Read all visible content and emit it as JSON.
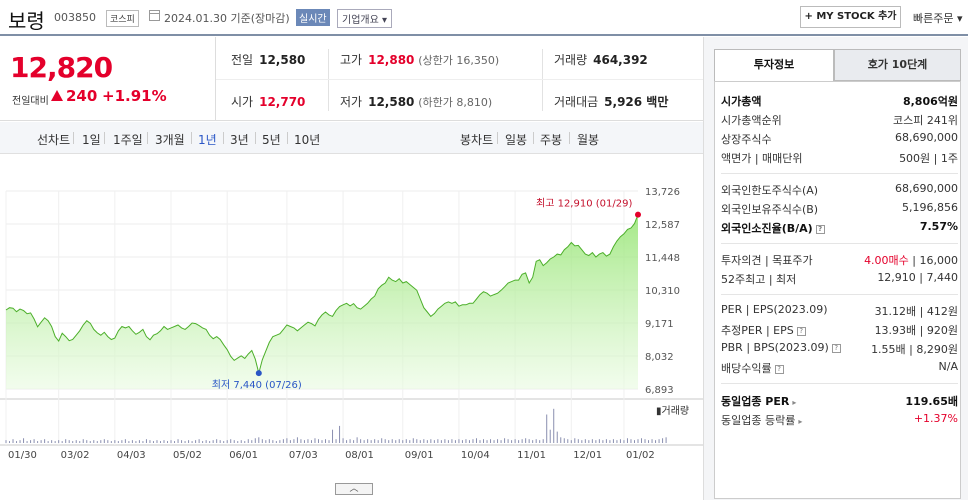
{
  "header": {
    "stock_name": "보령",
    "stock_code": "003850",
    "market": "코스피",
    "date_text": "2024.01.30 기준(장마감)",
    "realtime_label": "실시간",
    "company_info_label": "기업개요 ▾",
    "my_stock_label": "+ MY STOCK 추가",
    "quick_order_label": "빠른주문 ▾"
  },
  "price": {
    "current": "12,820",
    "change_label": "전일대비",
    "change": "240",
    "change_pct": "+1.91%"
  },
  "stats": {
    "prev_label": "전일",
    "prev": "12,580",
    "high_label": "고가",
    "high": "12,880",
    "upper_limit": "(상한가 16,350)",
    "volume_label": "거래량",
    "volume": "464,392",
    "open_label": "시가",
    "open": "12,770",
    "low_label": "저가",
    "low": "12,580",
    "lower_limit": "(하한가 8,810)",
    "amount_label": "거래대금",
    "amount": "5,926 백만"
  },
  "periods": {
    "line_label": "선차트",
    "line_items": [
      "1일",
      "1주일",
      "3개월",
      "1년",
      "3년",
      "5년",
      "10년"
    ],
    "selected": "1년",
    "candle_label": "봉차트",
    "candle_items": [
      "일봉",
      "주봉",
      "월봉"
    ]
  },
  "panel": {
    "tab_active": "투자정보",
    "tab_inactive": "호가 10단계",
    "market_cap_label": "시가총액",
    "market_cap": "8,806억원",
    "rank_label": "시가총액순위",
    "rank": "코스피 241위",
    "shares_label": "상장주식수",
    "shares": "68,690,000",
    "par_label": "액면가 | 매매단위",
    "par": "500원 | 1주",
    "foreign_limit_label": "외국인한도주식수(A)",
    "foreign_limit": "68,690,000",
    "foreign_hold_label": "외국인보유주식수(B)",
    "foreign_hold": "5,196,856",
    "foreign_ratio_label": "외국인소진율(B/A)",
    "foreign_ratio": "7.57%",
    "opinion_label": "투자의견 | 목표주가",
    "opinion": "4.00매수",
    "target": "| 16,000",
    "w52_label": "52주최고 | 최저",
    "w52": "12,910 | 7,440",
    "per_label": "PER | EPS(2023.09)",
    "per": "31.12배 | 412원",
    "est_per_label": "추정PER | EPS",
    "est_per": "13.93배 | 920원",
    "pbr_label": "PBR | BPS(2023.09)",
    "pbr": "1.55배 | 8,290원",
    "div_label": "배당수익률",
    "div": "N/A",
    "ind_per_label": "동일업종 PER",
    "ind_per": "119.65배",
    "ind_rate_label": "동일업종 등락률",
    "ind_rate": "+1.37%"
  },
  "chart_data": {
    "type": "area",
    "y_ticks": [
      13726,
      12587,
      11448,
      10310,
      9171,
      8032,
      6893
    ],
    "ylim": [
      6893,
      13726
    ],
    "x_tick_labels": [
      "01/30",
      "03/02",
      "04/03",
      "05/02",
      "06/01",
      "07/03",
      "08/01",
      "09/01",
      "10/04",
      "11/01",
      "12/01",
      "01/02"
    ],
    "values": [
      9620,
      9700,
      9680,
      9560,
      9650,
      9600,
      9490,
      9520,
      9310,
      9040,
      9200,
      9350,
      9250,
      9050,
      8700,
      8550,
      8820,
      8700,
      8560,
      8600,
      8750,
      8900,
      9100,
      9250,
      9160,
      8950,
      8830,
      8750,
      8850,
      8700,
      8600,
      8650,
      8900,
      9050,
      9000,
      9050,
      8900,
      8780,
      8850,
      8950,
      8700,
      8590,
      8750,
      8800,
      8900,
      9050,
      8950,
      9000,
      9050,
      9100,
      9000,
      8950,
      9050,
      9170,
      9150,
      9080,
      9000,
      8950,
      8750,
      8630,
      8700,
      8600,
      8420,
      8250,
      8020,
      7880,
      7960,
      8040,
      7950,
      8100,
      8220,
      7920,
      7440,
      7900,
      8200,
      8500,
      8700,
      8750,
      8800,
      8950,
      9100,
      9050,
      9000,
      8900,
      9000,
      9100,
      9200,
      9150,
      9070,
      9300,
      9450,
      9550,
      9450,
      9400,
      9600,
      9740,
      9800,
      9850,
      9760,
      9840,
      9700,
      9650,
      9750,
      9850,
      10000,
      10100,
      10350,
      10470,
      10550,
      10750,
      10650,
      10600,
      10700,
      10550,
      10600,
      10500,
      10400,
      10300,
      10000,
      9700,
      9550,
      9400,
      9500,
      9650,
      9750,
      9850,
      9900,
      9850,
      9900,
      9750,
      9800,
      9800,
      9850,
      9850,
      10000,
      10150,
      10250,
      10200,
      10100,
      10150,
      10200,
      10300,
      10420,
      10550,
      10600,
      10650,
      10650,
      10850,
      10900,
      10550,
      10750,
      11300,
      11350,
      11150,
      11250,
      11380,
      11450,
      11550,
      11520,
      11700,
      11800,
      11950,
      11830,
      11850,
      11700,
      11550,
      11500,
      11600,
      11450,
      11550,
      11600,
      11480,
      11550,
      11800,
      12000,
      12150,
      12250,
      12400,
      12450,
      12600,
      12910
    ],
    "high_label": "최고 12,910 (01/29)",
    "low_label": "최저 7,440 (07/26)",
    "low_index": 72,
    "volume_label": "▮거래량",
    "volumes": [
      3,
      2,
      4,
      2,
      3,
      5,
      2,
      3,
      4,
      2,
      3,
      4,
      2,
      3,
      2,
      3,
      2,
      4,
      3,
      2,
      3,
      2,
      4,
      3,
      2,
      3,
      2,
      3,
      4,
      3,
      2,
      3,
      2,
      3,
      4,
      2,
      3,
      2,
      3,
      2,
      4,
      3,
      2,
      3,
      2,
      3,
      2,
      3,
      2,
      4,
      3,
      2,
      3,
      2,
      3,
      4,
      2,
      3,
      2,
      3,
      4,
      3,
      2,
      3,
      4,
      3,
      2,
      3,
      2,
      4,
      3,
      5,
      6,
      4,
      3,
      4,
      3,
      2,
      3,
      4,
      5,
      3,
      4,
      6,
      4,
      3,
      4,
      3,
      5,
      4,
      3,
      4,
      3,
      14,
      4,
      18,
      5,
      3,
      4,
      3,
      6,
      4,
      3,
      4,
      3,
      4,
      3,
      5,
      4,
      3,
      4,
      3,
      4,
      3,
      4,
      3,
      5,
      4,
      3,
      4,
      3,
      4,
      3,
      4,
      3,
      4,
      3,
      4,
      3,
      4,
      3,
      4,
      3,
      4,
      5,
      3,
      4,
      3,
      4,
      3,
      4,
      3,
      5,
      4,
      3,
      4,
      3,
      4,
      5,
      4,
      3,
      4,
      3,
      4,
      30,
      14,
      36,
      12,
      6,
      5,
      4,
      3,
      5,
      4,
      3,
      4,
      3,
      4,
      3,
      4,
      3,
      4,
      3,
      4,
      3,
      4,
      3,
      5,
      4,
      3,
      4,
      5,
      4,
      3,
      4,
      3,
      4,
      5,
      6
    ]
  }
}
